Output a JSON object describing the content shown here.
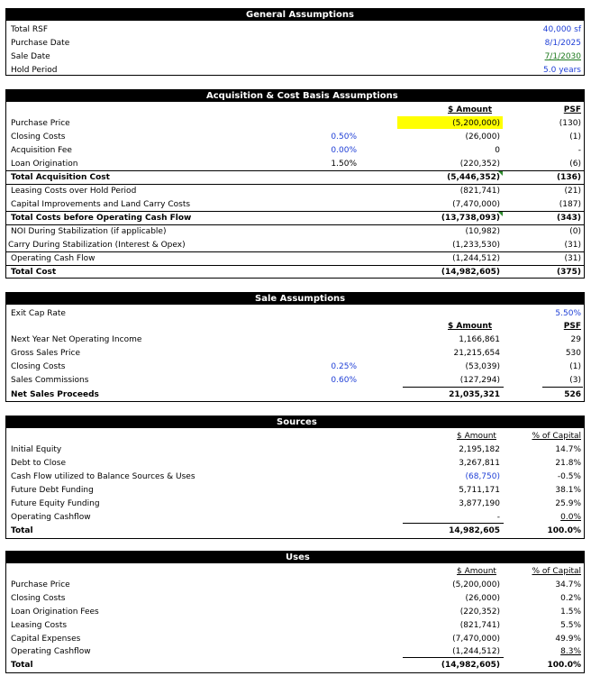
{
  "general": {
    "title": "General Assumptions",
    "rows": [
      {
        "label": "Total RSF",
        "value": "40,000 sf"
      },
      {
        "label": "Purchase Date",
        "value": "8/1/2025"
      },
      {
        "label": "Sale Date",
        "value": "7/1/2030"
      },
      {
        "label": "Hold Period",
        "value": "5.0 years"
      }
    ]
  },
  "acquisition": {
    "title": "Acquisition & Cost Basis Assumptions",
    "col_amount": "$ Amount",
    "col_psf": "PSF",
    "rows": [
      {
        "label": "Purchase Price",
        "pct": "",
        "amount": "(5,200,000)",
        "psf": "(130)"
      },
      {
        "label": "Closing Costs",
        "pct": "0.50%",
        "amount": "(26,000)",
        "psf": "(1)"
      },
      {
        "label": "Acquisition Fee",
        "pct": "0.00%",
        "amount": "0",
        "psf": "-"
      },
      {
        "label": "Loan Origination",
        "pct": "1.50%",
        "amount": "(220,352)",
        "psf": "(6)"
      },
      {
        "label": "Total Acquisition Cost",
        "pct": "",
        "amount": "(5,446,352)",
        "psf": "(136)"
      },
      {
        "label": "Leasing Costs over Hold Period",
        "pct": "",
        "amount": "(821,741)",
        "psf": "(21)"
      },
      {
        "label": "Capital Improvements and Land Carry Costs",
        "pct": "",
        "amount": "(7,470,000)",
        "psf": "(187)"
      },
      {
        "label": "Total Costs before Operating Cash Flow",
        "pct": "",
        "amount": "(13,738,093)",
        "psf": "(343)"
      },
      {
        "label": "NOI During Stabilization (if applicable)",
        "pct": "",
        "amount": "(10,982)",
        "psf": "(0)"
      },
      {
        "label": "Carry During Stabilization (Interest & Opex)",
        "pct": "",
        "amount": "(1,233,530)",
        "psf": "(31)"
      },
      {
        "label": "Operating Cash Flow",
        "pct": "",
        "amount": "(1,244,512)",
        "psf": "(31)"
      },
      {
        "label": "Total Cost",
        "pct": "",
        "amount": "(14,982,605)",
        "psf": "(375)"
      }
    ]
  },
  "sale": {
    "title": "Sale Assumptions",
    "exit_cap_label": "Exit Cap Rate",
    "exit_cap_value": "5.50%",
    "col_amount": "$ Amount",
    "col_psf": "PSF",
    "rows": [
      {
        "label": "Next Year Net Operating Income",
        "pct": "",
        "amount": "1,166,861",
        "psf": "29"
      },
      {
        "label": "Gross Sales Price",
        "pct": "",
        "amount": "21,215,654",
        "psf": "530"
      },
      {
        "label": "Closing Costs",
        "pct": "0.25%",
        "amount": "(53,039)",
        "psf": "(1)"
      },
      {
        "label": "Sales Commissions",
        "pct": "0.60%",
        "amount": "(127,294)",
        "psf": "(3)"
      },
      {
        "label": "Net Sales Proceeds",
        "pct": "",
        "amount": "21,035,321",
        "psf": "526"
      }
    ]
  },
  "sources": {
    "title": "Sources",
    "col_amount": "$ Amount",
    "col_pct": "% of Capital",
    "rows": [
      {
        "label": "Initial Equity",
        "amount": "2,195,182",
        "pct": "14.7%"
      },
      {
        "label": "Debt to Close",
        "amount": "3,267,811",
        "pct": "21.8%"
      },
      {
        "label": "Cash Flow utilized to Balance Sources & Uses",
        "amount": "(68,750)",
        "pct": "-0.5%"
      },
      {
        "label": "Future Debt Funding",
        "amount": "5,711,171",
        "pct": "38.1%"
      },
      {
        "label": "Future Equity Funding",
        "amount": "3,877,190",
        "pct": "25.9%"
      },
      {
        "label": "Operating Cashflow",
        "amount": "-",
        "pct": "0.0%"
      },
      {
        "label": "Total",
        "amount": "14,982,605",
        "pct": "100.0%"
      }
    ]
  },
  "uses": {
    "title": "Uses",
    "col_amount": "$ Amount",
    "col_pct": "% of Capital",
    "rows": [
      {
        "label": "Purchase Price",
        "amount": "(5,200,000)",
        "pct": "34.7%"
      },
      {
        "label": "Closing Costs",
        "amount": "(26,000)",
        "pct": "0.2%"
      },
      {
        "label": "Loan Origination Fees",
        "amount": "(220,352)",
        "pct": "1.5%"
      },
      {
        "label": "Leasing Costs",
        "amount": "(821,741)",
        "pct": "5.5%"
      },
      {
        "label": "Capital Expenses",
        "amount": "(7,470,000)",
        "pct": "49.9%"
      },
      {
        "label": "Operating Cashflow",
        "amount": "(1,244,512)",
        "pct": "8.3%"
      },
      {
        "label": "Total",
        "amount": "(14,982,605)",
        "pct": "100.0%"
      }
    ]
  },
  "colors": {
    "input_blue": "#1f3fd6",
    "highlight": "#ffff00",
    "link_green": "#1e7a1e"
  }
}
